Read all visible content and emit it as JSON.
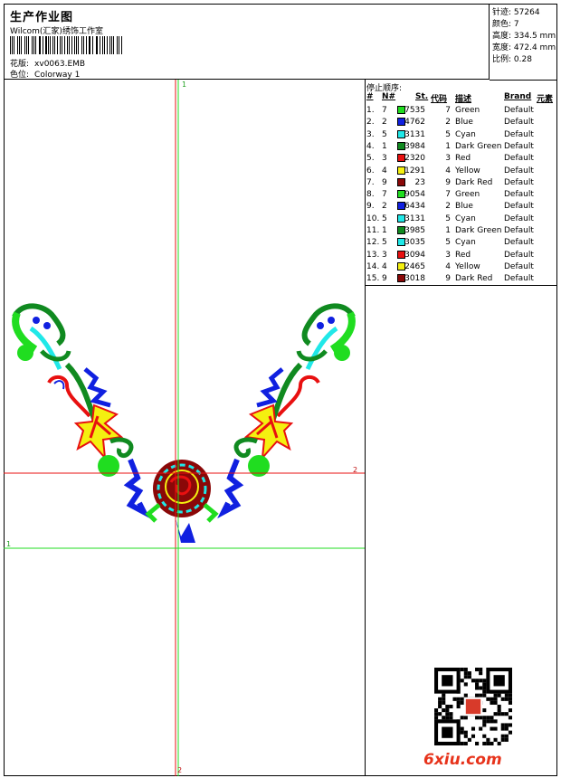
{
  "header": {
    "title": "生产作业图",
    "company": "Wilcom(汇家)绣饰工作室",
    "design_label": "花版:",
    "design_value": "xv0063.EMB",
    "colorway_label": "色位:",
    "colorway_value": "Colorway 1"
  },
  "stats": [
    {
      "label": "针迹:",
      "value": "57264"
    },
    {
      "label": "颜色:",
      "value": "7"
    },
    {
      "label": "高度:",
      "value": "334.5 mm"
    },
    {
      "label": "宽度:",
      "value": "472.4 mm"
    },
    {
      "label": "比例:",
      "value": "0.28"
    }
  ],
  "stop_sequence": {
    "title": "停止顺序:",
    "headers": {
      "idx": "#",
      "n": "N#",
      "st": "St.",
      "code": "代码",
      "desc": "描述",
      "brand": "Brand",
      "elem": "元素"
    },
    "rows": [
      {
        "idx": "1.",
        "n": "7",
        "color": "#20dd20",
        "st": "7535",
        "code": "7",
        "desc": "Green",
        "brand": "Default"
      },
      {
        "idx": "2.",
        "n": "2",
        "color": "#1020e0",
        "st": "4762",
        "code": "2",
        "desc": "Blue",
        "brand": "Default"
      },
      {
        "idx": "3.",
        "n": "5",
        "color": "#20e8e8",
        "st": "3131",
        "code": "5",
        "desc": "Cyan",
        "brand": "Default"
      },
      {
        "idx": "4.",
        "n": "1",
        "color": "#108a20",
        "st": "3984",
        "code": "1",
        "desc": "Dark Green",
        "brand": "Default"
      },
      {
        "idx": "5.",
        "n": "3",
        "color": "#e81010",
        "st": "2320",
        "code": "3",
        "desc": "Red",
        "brand": "Default"
      },
      {
        "idx": "6.",
        "n": "4",
        "color": "#f4f010",
        "st": "1291",
        "code": "4",
        "desc": "Yellow",
        "brand": "Default"
      },
      {
        "idx": "7.",
        "n": "9",
        "color": "#8a0808",
        "st": "23",
        "code": "9",
        "desc": "Dark Red",
        "brand": "Default"
      },
      {
        "idx": "8.",
        "n": "7",
        "color": "#20dd20",
        "st": "9054",
        "code": "7",
        "desc": "Green",
        "brand": "Default"
      },
      {
        "idx": "9.",
        "n": "2",
        "color": "#1020e0",
        "st": "6434",
        "code": "2",
        "desc": "Blue",
        "brand": "Default"
      },
      {
        "idx": "10.",
        "n": "5",
        "color": "#20e8e8",
        "st": "3131",
        "code": "5",
        "desc": "Cyan",
        "brand": "Default"
      },
      {
        "idx": "11.",
        "n": "1",
        "color": "#108a20",
        "st": "3985",
        "code": "1",
        "desc": "Dark Green",
        "brand": "Default"
      },
      {
        "idx": "12.",
        "n": "5",
        "color": "#20e8e8",
        "st": "3035",
        "code": "5",
        "desc": "Cyan",
        "brand": "Default"
      },
      {
        "idx": "13.",
        "n": "3",
        "color": "#e81010",
        "st": "3094",
        "code": "3",
        "desc": "Red",
        "brand": "Default"
      },
      {
        "idx": "14.",
        "n": "4",
        "color": "#f4f010",
        "st": "2465",
        "code": "4",
        "desc": "Yellow",
        "brand": "Default"
      },
      {
        "idx": "15.",
        "n": "9",
        "color": "#8a0808",
        "st": "3018",
        "code": "9",
        "desc": "Dark Red",
        "brand": "Default"
      }
    ]
  },
  "guides": {
    "v_green": "1",
    "h_red": "2",
    "h_green": "1",
    "v_red": "2"
  },
  "watermark": "6xiu.com"
}
